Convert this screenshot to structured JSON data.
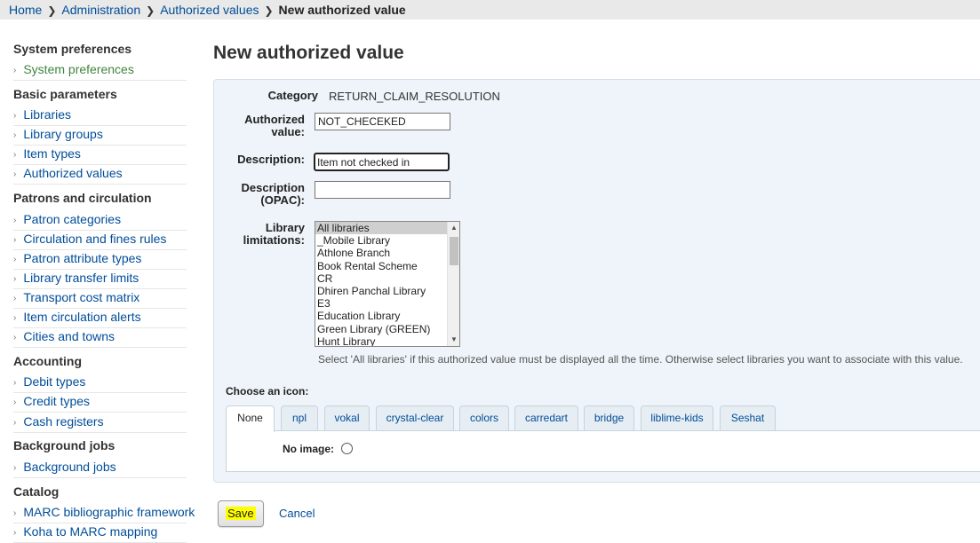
{
  "breadcrumb": {
    "items": [
      "Home",
      "Administration",
      "Authorized values"
    ],
    "current": "New authorized value"
  },
  "sidebar": {
    "sections": [
      {
        "heading": "System preferences",
        "items": [
          "System preferences"
        ]
      },
      {
        "heading": "Basic parameters",
        "items": [
          "Libraries",
          "Library groups",
          "Item types",
          "Authorized values"
        ]
      },
      {
        "heading": "Patrons and circulation",
        "items": [
          "Patron categories",
          "Circulation and fines rules",
          "Patron attribute types",
          "Library transfer limits",
          "Transport cost matrix",
          "Item circulation alerts",
          "Cities and towns"
        ]
      },
      {
        "heading": "Accounting",
        "items": [
          "Debit types",
          "Credit types",
          "Cash registers"
        ]
      },
      {
        "heading": "Background jobs",
        "items": [
          "Background jobs"
        ]
      },
      {
        "heading": "Catalog",
        "items": [
          "MARC bibliographic framework",
          "Koha to MARC mapping"
        ]
      }
    ]
  },
  "page": {
    "title": "New authorized value"
  },
  "form": {
    "category_label": "Category",
    "category_value": "RETURN_CLAIM_RESOLUTION",
    "authorized_value_label_1": "Authorized",
    "authorized_value_label_2": "value:",
    "authorized_value": "NOT_CHECEKED",
    "description_label": "Description:",
    "description_value": "Item not checked in",
    "description_opac_label_1": "Description",
    "description_opac_label_2": "(OPAC):",
    "description_opac_value": "",
    "library_label_1": "Library",
    "library_label_2": "limitations:",
    "library_options": [
      "All libraries",
      "_Mobile Library",
      "Athlone Branch",
      "Book Rental Scheme",
      "CR",
      "Dhiren Panchal Library",
      "E3",
      "Education Library",
      "Green Library (GREEN)",
      "Hunt Library"
    ],
    "library_selected": "All libraries",
    "library_hint": "Select 'All libraries' if this authorized value must be displayed all the time. Otherwise select libraries you want to associate with this value.",
    "choose_icon_label": "Choose an icon:",
    "icon_tabs": [
      "None",
      "npl",
      "vokal",
      "crystal-clear",
      "colors",
      "carredart",
      "bridge",
      "liblime-kids",
      "Seshat"
    ],
    "active_tab": "None",
    "no_image_label": "No image:"
  },
  "actions": {
    "save_label": "Save",
    "cancel_label": "Cancel"
  },
  "colors": {
    "link": "#004d99",
    "active_menu": "#408540",
    "panel_bg": "#eef4f9",
    "highlight": "#ffff00"
  }
}
